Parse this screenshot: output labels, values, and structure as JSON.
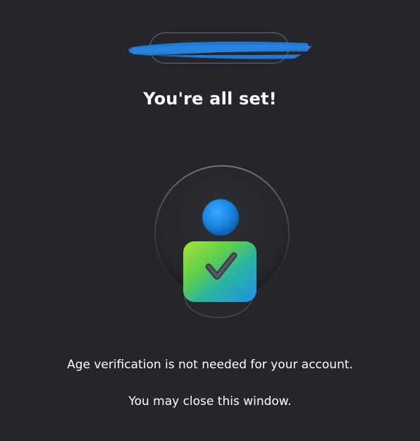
{
  "header": {
    "account_label": ""
  },
  "main": {
    "title": "You're all set!",
    "message_primary": "Age verification is not needed for your account.",
    "message_secondary": "You may close this window."
  },
  "colors": {
    "background": "#24262b",
    "redaction": "#1f7ad6",
    "avatar_head": "#1a86e0",
    "avatar_body_green": "#8ad12a",
    "avatar_body_blue": "#1f8fe8"
  },
  "icons": {
    "illustration": "user-verified-icon",
    "check": "checkmark-icon"
  }
}
